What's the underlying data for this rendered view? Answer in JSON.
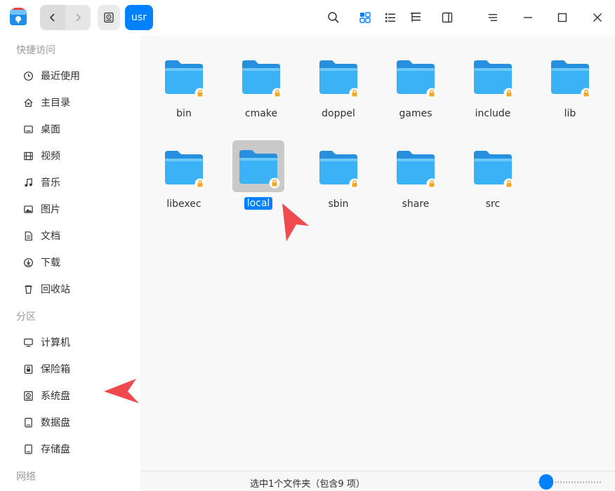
{
  "toolbar": {
    "breadcrumb_current": "usr"
  },
  "sidebar": {
    "sections": {
      "quick_access": "快捷访问",
      "partitions": "分区",
      "network": "网络"
    },
    "items": [
      {
        "label": "最近使用",
        "icon": "clock-icon"
      },
      {
        "label": "主目录",
        "icon": "home-icon"
      },
      {
        "label": "桌面",
        "icon": "desktop-icon"
      },
      {
        "label": "视频",
        "icon": "video-icon"
      },
      {
        "label": "音乐",
        "icon": "music-icon"
      },
      {
        "label": "图片",
        "icon": "picture-icon"
      },
      {
        "label": "文档",
        "icon": "document-icon"
      },
      {
        "label": "下载",
        "icon": "download-icon"
      },
      {
        "label": "回收站",
        "icon": "trash-icon"
      },
      {
        "label": "计算机",
        "icon": "computer-icon"
      },
      {
        "label": "保险箱",
        "icon": "safe-icon"
      },
      {
        "label": "系统盘",
        "icon": "system-disk-icon"
      },
      {
        "label": "数据盘",
        "icon": "disk-icon"
      },
      {
        "label": "存储盘",
        "icon": "disk-icon"
      }
    ]
  },
  "files": [
    {
      "name": "bin"
    },
    {
      "name": "cmake"
    },
    {
      "name": "doppel"
    },
    {
      "name": "games"
    },
    {
      "name": "include"
    },
    {
      "name": "lib"
    },
    {
      "name": "libexec"
    },
    {
      "name": "local",
      "selected": true
    },
    {
      "name": "sbin"
    },
    {
      "name": "share"
    },
    {
      "name": "src"
    }
  ],
  "status": {
    "text": "选中1个文件夹（包含9 项）"
  },
  "colors": {
    "accent": "#0081ff",
    "folder": "#2ba8f0",
    "lock": "#f5a623",
    "annotation_arrow": "#f04a4f"
  }
}
